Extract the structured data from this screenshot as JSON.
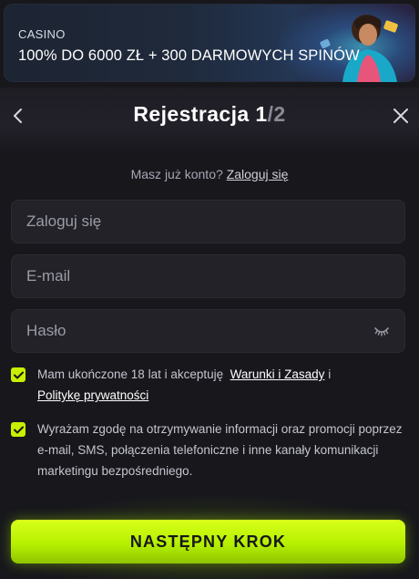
{
  "banner": {
    "label": "CASINO",
    "title": "100% DO 6000 ZŁ + 300 DARMOWYCH SPINÓW"
  },
  "header": {
    "title": "Rejestracja",
    "step_current": "1",
    "step_total": "/2"
  },
  "login_prompt": {
    "text": "Masz już konto?",
    "link": "Zaloguj się"
  },
  "form": {
    "login_placeholder": "Zaloguj się",
    "email_placeholder": "E-mail",
    "password_placeholder": "Hasło"
  },
  "consents": {
    "age": {
      "text_before": "Mam ukończone 18 lat i akceptuję",
      "terms_link": "Warunki i Zasady",
      "and": "i",
      "privacy_link": "Politykę prywatności",
      "checked": true
    },
    "marketing": {
      "text": "Wyrażam zgodę na otrzymywanie informacji oraz promocji poprzez e-mail, SMS, połączenia telefoniczne i inne kanały komunikacji marketingu bezpośredniego.",
      "checked": true
    }
  },
  "cta": {
    "label": "NASTĘPNY KROK"
  },
  "colors": {
    "accent": "#c8f000",
    "background": "#17171c",
    "field": "#222228"
  },
  "icons": [
    "back-arrow-icon",
    "close-icon",
    "eye-closed-icon",
    "checkmark-icon"
  ]
}
